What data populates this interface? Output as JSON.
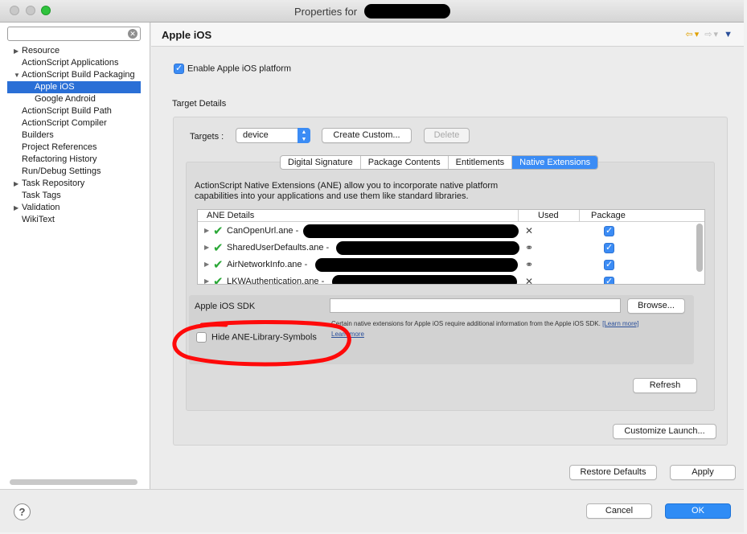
{
  "window": {
    "title": "Properties for"
  },
  "sidebar": {
    "filter_placeholder": "",
    "items": [
      {
        "label": "Resource",
        "expander": "▶"
      },
      {
        "label": "ActionScript Applications",
        "expander": ""
      },
      {
        "label": "ActionScript Build Packaging",
        "expander": "▼"
      },
      {
        "label": "Apple iOS",
        "expander": ""
      },
      {
        "label": "Google Android",
        "expander": ""
      },
      {
        "label": "ActionScript Build Path",
        "expander": ""
      },
      {
        "label": "ActionScript Compiler",
        "expander": ""
      },
      {
        "label": "Builders",
        "expander": ""
      },
      {
        "label": "Project References",
        "expander": ""
      },
      {
        "label": "Refactoring History",
        "expander": ""
      },
      {
        "label": "Run/Debug Settings",
        "expander": ""
      },
      {
        "label": "Task Repository",
        "expander": "▶"
      },
      {
        "label": "Task Tags",
        "expander": ""
      },
      {
        "label": "Validation",
        "expander": "▶"
      },
      {
        "label": "WikiText",
        "expander": ""
      }
    ],
    "selected_index": 3
  },
  "page": {
    "title": "Apple iOS",
    "enable_label": "Enable Apple iOS platform",
    "target_details_label": "Target Details",
    "targets_label": "Targets :",
    "targets_value": "device",
    "create_custom_label": "Create Custom...",
    "delete_label": "Delete",
    "tabs": [
      "Digital Signature",
      "Package Contents",
      "Entitlements",
      "Native Extensions"
    ],
    "active_tab": 3,
    "ane_description": "ActionScript Native Extensions (ANE) allow you to incorporate native platform capabilities into your applications and use them like standard libraries.",
    "table": {
      "headers": [
        "ANE Details",
        "Used",
        "Package"
      ],
      "rows": [
        {
          "name": "CanOpenUrl.ane -",
          "used_icon": "✕"
        },
        {
          "name": "SharedUserDefaults.ane -",
          "used_icon": "⚭"
        },
        {
          "name": "AirNetworkInfo.ane -",
          "used_icon": "⚭"
        },
        {
          "name": "LKWAuthentication.ane -",
          "used_icon": "✕"
        }
      ]
    },
    "sdk_label": "Apple iOS SDK",
    "browse_label": "Browse...",
    "sdk_note": "Certain native extensions for Apple iOS require additional information from the  Apple iOS SDK.",
    "learn_more": "[Learn more]",
    "learn_more_2": "Learn more",
    "hide_ane_label": "Hide ANE-Library-Symbols",
    "refresh_label": "Refresh",
    "customize_launch_label": "Customize Launch...",
    "restore_defaults_label": "Restore Defaults",
    "apply_label": "Apply"
  },
  "footer": {
    "help_icon": "?",
    "cancel_label": "Cancel",
    "ok_label": "OK"
  },
  "colors": {
    "accent": "#3b8cf5",
    "annotation": "#ff0a0a",
    "check_green": "#2aa836"
  }
}
